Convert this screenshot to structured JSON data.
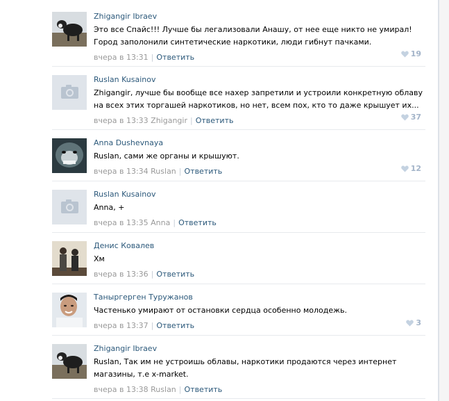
{
  "comments": [
    {
      "author": "Zhigangir Ibraev",
      "text": "Это все Спайс!!! Лучше бы легализовали Анашу, от нее еще никто не умирал! Город заполонили синтетические наркотики, люди гибнут пачками.",
      "time": "вчера в 13:31",
      "reply_to": "",
      "reply_label": "Ответить",
      "likes": "19",
      "avatar": "dog-photo"
    },
    {
      "author": "Ruslan Kusainov",
      "text": "Zhigangir, лучше бы вообще все нахер запретили и устроили конкретную облаву на всех этих торгашей наркотиков, но нет, всем пох, кто то даже крышует их...",
      "time": "вчера в 13:33",
      "reply_to": "Zhigangir",
      "reply_label": "Ответить",
      "likes": "37",
      "avatar": "camera-placeholder"
    },
    {
      "author": "Anna Dushevnaya",
      "text": "Ruslan, сами же органы и крышуют.",
      "time": "вчера в 13:34",
      "reply_to": "Ruslan",
      "reply_label": "Ответить",
      "likes": "12",
      "avatar": "lion-photo"
    },
    {
      "author": "Ruslan Kusainov",
      "text": "Anna, +",
      "time": "вчера в 13:35",
      "reply_to": "Anna",
      "reply_label": "Ответить",
      "likes": "",
      "avatar": "camera-placeholder"
    },
    {
      "author": "Денис Ковалев",
      "text": "Хм",
      "time": "вчера в 13:36",
      "reply_to": "",
      "reply_label": "Ответить",
      "likes": "",
      "avatar": "people-photo"
    },
    {
      "author": "Таныргерген Туружанов",
      "text": "Частенько умирают от остановки сердца особенно молодежь.",
      "time": "вчера в 13:37",
      "reply_to": "",
      "reply_label": "Ответить",
      "likes": "3",
      "avatar": "face-photo"
    },
    {
      "author": "Zhigangir Ibraev",
      "text": "Ruslan, Так им не устроишь облавы, наркотики продаются через интернет магазины, т.е x-market.",
      "time": "вчера в 13:38",
      "reply_to": "Ruslan",
      "reply_label": "Ответить",
      "likes": "",
      "avatar": "dog-photo"
    }
  ],
  "colors": {
    "link": "#2b587a",
    "meta": "#999999",
    "likes": "#a3b4c9",
    "divider": "#e7eaed"
  }
}
